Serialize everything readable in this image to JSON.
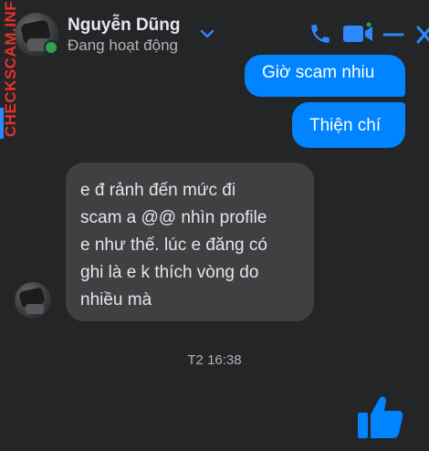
{
  "header": {
    "name": "Nguyễn Dũng",
    "status": "Đang hoạt động",
    "icons": [
      "chevron-down-icon",
      "phone-icon",
      "video-icon",
      "minimize-icon",
      "close-icon"
    ]
  },
  "watermark": {
    "text": "CHECKSCAM.INFO"
  },
  "messages": {
    "outgoing": [
      {
        "text": "Giờ scam nhiu"
      },
      {
        "text": "Thiện chí"
      }
    ],
    "incoming": {
      "lines": [
        "e đ rảnh đến mức đi",
        "scam a @@ nhìn profile",
        "e như thế. lúc e đăng có",
        "ghi là e k thích vòng do",
        "nhiều mà"
      ]
    },
    "timestamp": "T2 16:38"
  },
  "colors": {
    "background": "#242526",
    "accent": "#0084ff",
    "incoming_bubble": "#3e4042",
    "online": "#31a24c",
    "watermark": "#e4322b"
  }
}
